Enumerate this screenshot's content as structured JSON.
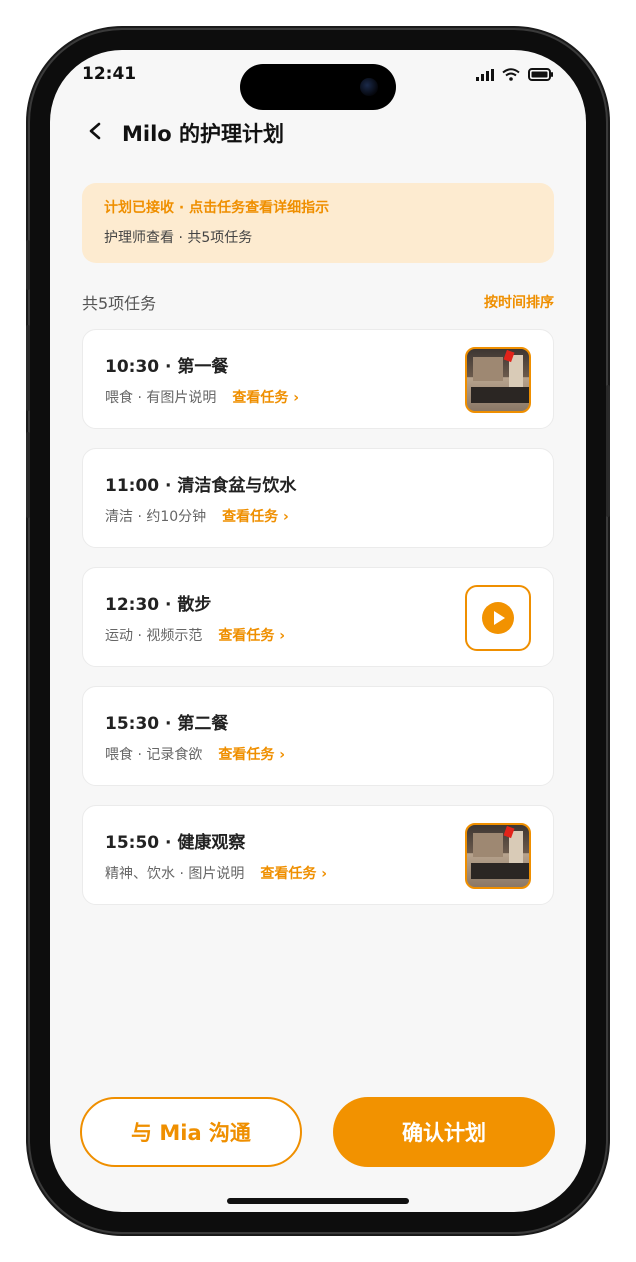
{
  "status_bar": {
    "time": "12:41"
  },
  "header": {
    "back_icon": "chevron-left-icon",
    "title": "Milo 的护理计划"
  },
  "notice": {
    "line1": "计划已接收 · 点击任务查看详细指示",
    "line2": "护理师查看 · 共5项任务"
  },
  "section": {
    "title": "共5项任务",
    "sort_label": "按时间排序"
  },
  "tasks": [
    {
      "title": "10:30 · 第一餐",
      "subtitle": "喂食 · 有图片说明",
      "link": "查看任务 ›",
      "media": "image"
    },
    {
      "title": "11:00 · 清洁食盆与饮水",
      "subtitle": "清洁 · 约10分钟",
      "link": "查看任务 ›",
      "media": "none"
    },
    {
      "title": "12:30 · 散步",
      "subtitle": "运动 · 视频示范",
      "link": "查看任务 ›",
      "media": "video"
    },
    {
      "title": "15:30 · 第二餐",
      "subtitle": "喂食 · 记录食欲",
      "link": "查看任务 ›",
      "media": "none"
    },
    {
      "title": "15:50 · 健康观察",
      "subtitle": "精神、饮水 · 图片说明",
      "link": "查看任务 ›",
      "media": "image"
    }
  ],
  "actions": {
    "chat_label": "与 Mia 沟通",
    "confirm_label": "确认计划"
  },
  "colors": {
    "accent": "#f29200",
    "notice_bg": "#fdebd0"
  }
}
